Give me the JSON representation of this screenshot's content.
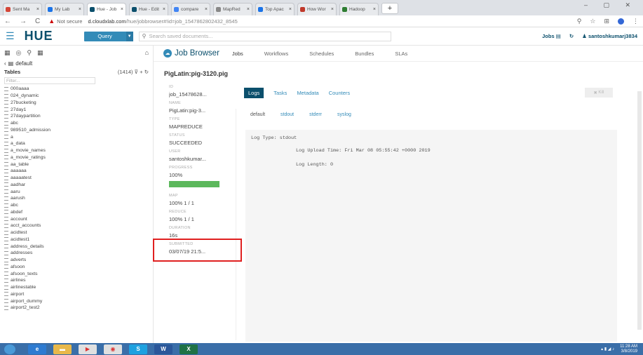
{
  "browser": {
    "tabs": [
      {
        "label": "Sent Ma",
        "color": "#d44638"
      },
      {
        "label": "My Lab",
        "color": "#1a73e8"
      },
      {
        "label": "Hue - Job",
        "color": "#0b4f6c"
      },
      {
        "label": "Hue - Edit",
        "color": "#0b4f6c"
      },
      {
        "label": "compare",
        "color": "#4285f4"
      },
      {
        "label": "MapRed",
        "color": "#888888"
      },
      {
        "label": "Top Apac",
        "color": "#1a73e8"
      },
      {
        "label": "How Wor",
        "color": "#c0392b"
      },
      {
        "label": "Hadoop",
        "color": "#2e7d32"
      }
    ],
    "security": "Not secure",
    "url_host": "d.cloudxlab.com",
    "url_path": "/hue/jobbrowser#!id=job_1547862802432_8545"
  },
  "header": {
    "logo": "HUE",
    "query_button": "Query",
    "search_placeholder": "Search saved documents...",
    "jobs_label": "Jobs",
    "user": "santoshkumarj3834"
  },
  "left_panel": {
    "database": "default",
    "tables_label": "Tables",
    "count": "(1414)",
    "filter_placeholder": "Filter...",
    "tables": [
      "000aaaa",
      "024_dynamic",
      "27bucketing",
      "27day1",
      "27daypartition",
      "abc",
      "989510_admission",
      "a",
      "a_data",
      "a_movie_names",
      "a_movie_ratings",
      "aa_table",
      "aaaaaa",
      "aaaaatest",
      "aadhar",
      "aaru",
      "aarush",
      "abc",
      "abdef",
      "account",
      "acct_accounts",
      "acidtest",
      "acidtest1",
      "address_details",
      "addresses",
      "adverts",
      "afsoon",
      "afsoon_texts",
      "airlines",
      "airlinestable",
      "airport",
      "airport_dummy",
      "airport2_test2"
    ]
  },
  "main": {
    "title": "Job Browser",
    "tabs": [
      "Jobs",
      "Workflows",
      "Schedules",
      "Bundles",
      "SLAs"
    ],
    "job_title": "PigLatin:pig-3120.pig",
    "props": {
      "id_label": "ID",
      "id_value": "job_15478628...",
      "name_label": "NAME",
      "name_value": "PigLatin:pig-3...",
      "type_label": "TYPE",
      "type_value": "MAPREDUCE",
      "status_label": "STATUS",
      "status_value": "SUCCEEDED",
      "user_label": "USER",
      "user_value": "santoshkumar...",
      "progress_label": "PROGRESS",
      "progress_value": "100%",
      "progress_fraction": 1.0,
      "map_label": "MAP",
      "map_value": "100% 1 / 1",
      "reduce_label": "REDUCE",
      "reduce_value": "100% 1 / 1",
      "duration_label": "DURATION",
      "duration_value": "16s",
      "submitted_label": "SUBMITTED",
      "submitted_value": "03/07/19 21:5..."
    },
    "subtabs": [
      "Logs",
      "Tasks",
      "Metadata",
      "Counters"
    ],
    "kill_label": "Kill",
    "logtabs": [
      "default",
      "stdout",
      "stderr",
      "syslog"
    ],
    "log_lines": [
      "Log Type: stdout",
      "Log Upload Time: Fri Mar 08 05:55:42 +0000 2019",
      "Log Length: 0"
    ]
  },
  "taskbar": {
    "time": "11:28 AM",
    "date": "3/8/2019"
  }
}
